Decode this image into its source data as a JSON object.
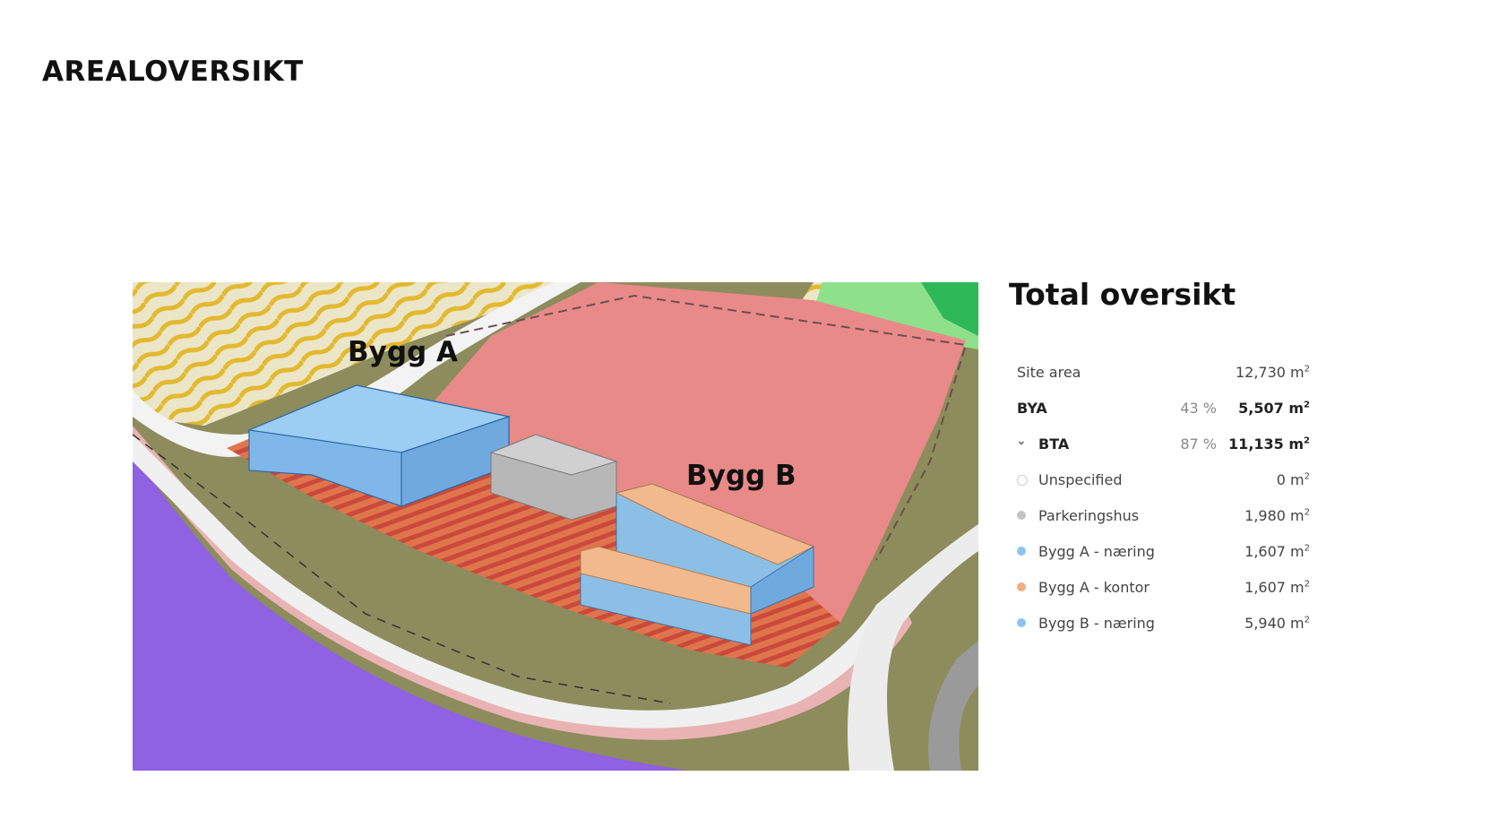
{
  "page": {
    "title": "AREALOVERSIKT"
  },
  "map": {
    "labels": {
      "bygg_a": "Bygg A",
      "bygg_b": "Bygg B"
    }
  },
  "panel": {
    "title": "Total oversikt",
    "unit_sup": "2",
    "rows": [
      {
        "label": "Site area",
        "pct": "",
        "value": "12,730 m",
        "type": "plain"
      },
      {
        "label": "BYA",
        "pct": "43 %",
        "value": "5,507 m",
        "type": "bold"
      },
      {
        "label": "BTA",
        "pct": "87 %",
        "value": "11,135 m",
        "type": "bold-chevron"
      },
      {
        "label": "Unspecified",
        "pct": "",
        "value": "0 m",
        "type": "item",
        "color": "#ffffff",
        "border": "#cccccc"
      },
      {
        "label": "Parkeringshus",
        "pct": "",
        "value": "1,980 m",
        "type": "item",
        "color": "#c4c4c4"
      },
      {
        "label": "Bygg A - næring",
        "pct": "",
        "value": "1,607 m",
        "type": "item",
        "color": "#8cc4ef"
      },
      {
        "label": "Bygg A - kontor",
        "pct": "",
        "value": "1,607 m",
        "type": "item",
        "color": "#f2ad82"
      },
      {
        "label": "Bygg B - næring",
        "pct": "",
        "value": "5,940 m",
        "type": "item",
        "color": "#8cc4ef"
      }
    ]
  },
  "icons": {
    "chevron": "chevron-down-icon",
    "dot": "legend-dot-icon"
  }
}
